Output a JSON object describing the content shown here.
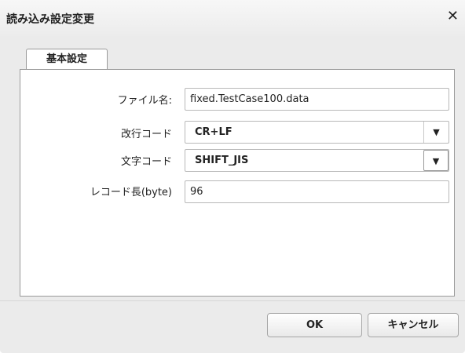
{
  "dialog": {
    "title": "読み込み設定変更",
    "close_glyph": "✕"
  },
  "tabs": [
    {
      "label": "基本設定",
      "active": true
    }
  ],
  "form": {
    "file_name": {
      "label": "ファイル名:",
      "value": "fixed.TestCase100.data"
    },
    "newline_code": {
      "label": "改行コード",
      "value": "CR+LF"
    },
    "char_code": {
      "label": "文字コード",
      "value": "SHIFT_JIS"
    },
    "record_length": {
      "label": "レコード長(byte)",
      "value": "96"
    }
  },
  "buttons": {
    "ok": "OK",
    "cancel": "キャンセル"
  }
}
